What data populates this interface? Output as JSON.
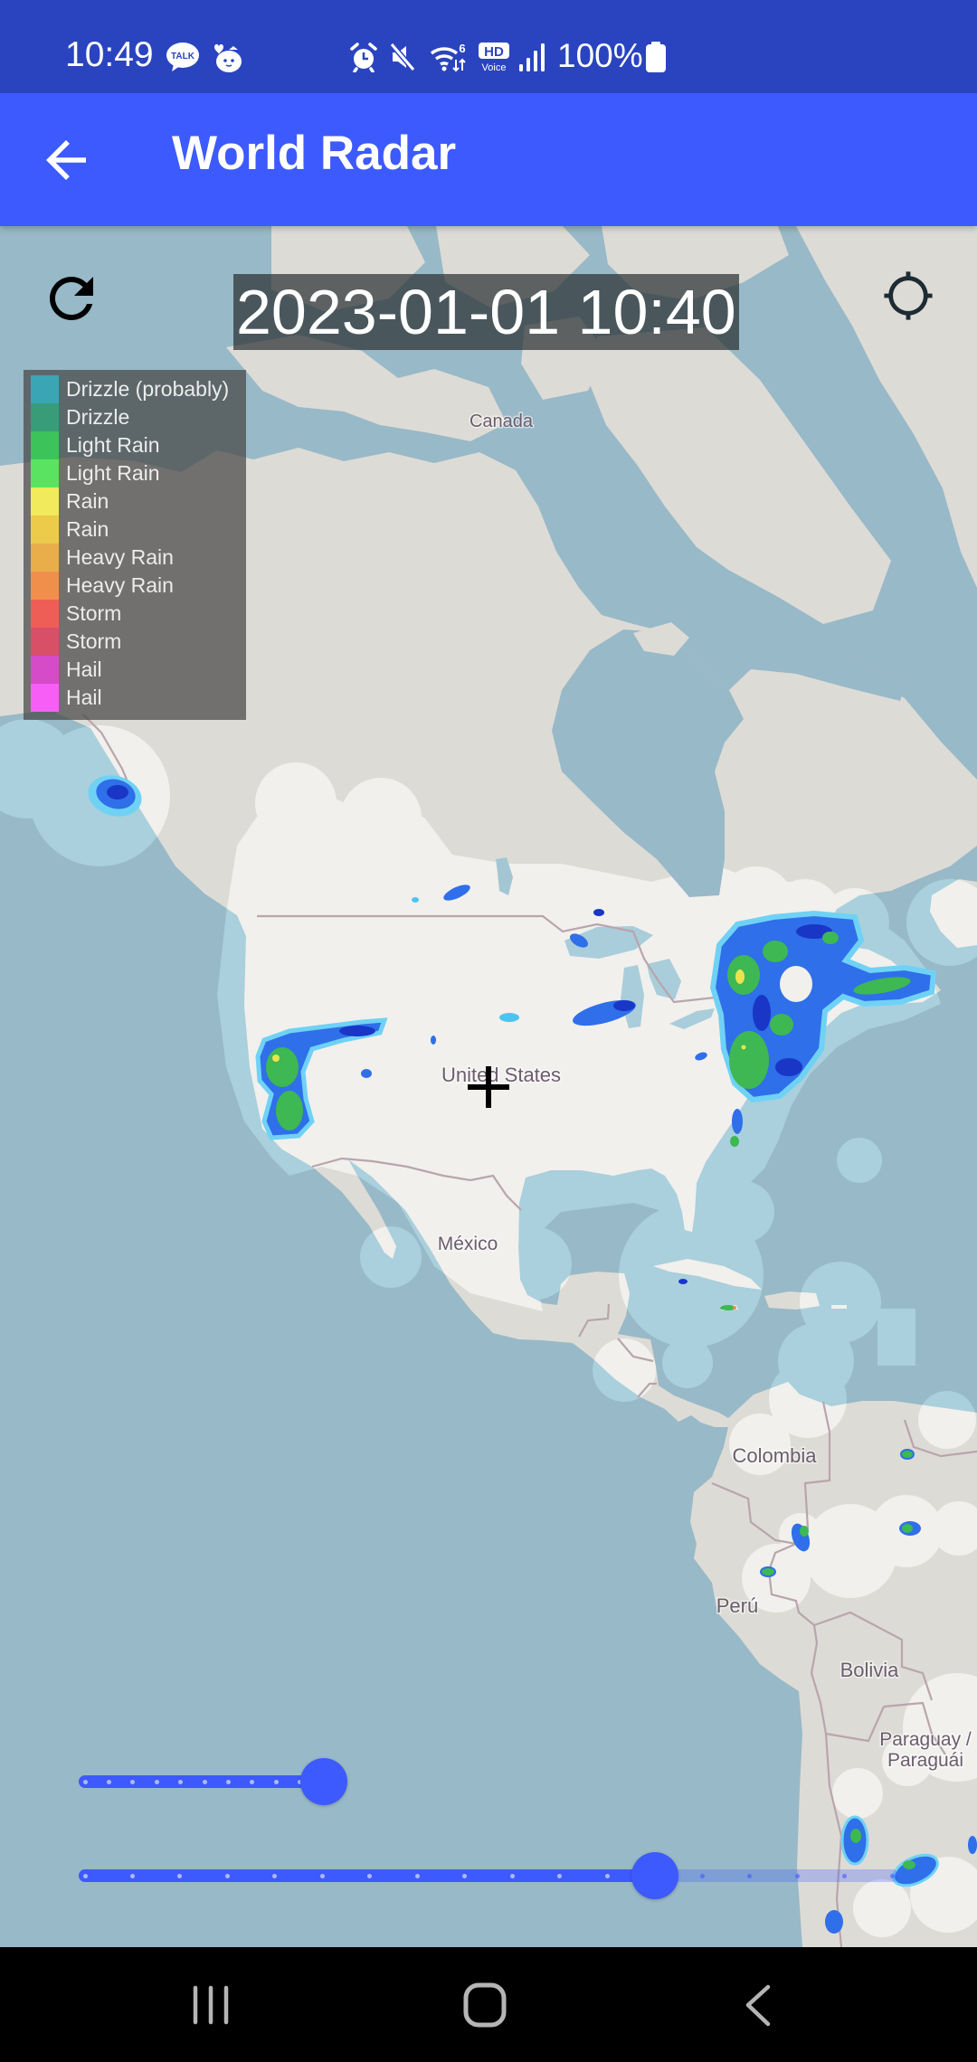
{
  "theme": {
    "status_bar": "#2a44c0",
    "app_bar": "#3d5afe",
    "accent": "#3d5afe"
  },
  "status_bar": {
    "time": "10:49",
    "notification_icons": [
      {
        "name": "kakaotalk-icon",
        "text": "TALK"
      },
      {
        "name": "kakao-character-icon"
      }
    ],
    "system_icons": [
      "alarm-icon",
      "mute-icon",
      "wifi-icon",
      "hd-voice-icon",
      "signal-icon",
      "battery-icon"
    ],
    "wifi_badge": "6",
    "hd_voice": {
      "top": "HD",
      "bottom": "Voice"
    },
    "battery_level": "100%"
  },
  "app_bar": {
    "title": "World Radar",
    "back_icon": "arrow-back-icon"
  },
  "map": {
    "timestamp": "2023-01-01 10:40",
    "refresh_icon": "refresh-icon",
    "locate_icon": "gps-locate-icon",
    "center_marker_icon": "crosshair-plus-icon",
    "labels": {
      "canada": "Canada",
      "united_states": "United States",
      "mexico": "México",
      "colombia": "Colombia",
      "peru": "Perú",
      "bolivia": "Bolivia",
      "paraguay_line1": "Paraguay /",
      "paraguay_line2": "Paraguái"
    }
  },
  "legend": {
    "items": [
      {
        "label": "Drizzle (probably)",
        "color": "#3aa6b5"
      },
      {
        "label": "Drizzle",
        "color": "#389c78"
      },
      {
        "label": "Light Rain",
        "color": "#3cc45a"
      },
      {
        "label": "Light Rain",
        "color": "#5ae360"
      },
      {
        "label": "Rain",
        "color": "#f0ea5c"
      },
      {
        "label": "Rain",
        "color": "#eccb4b"
      },
      {
        "label": "Heavy Rain",
        "color": "#e9ae4a"
      },
      {
        "label": "Heavy Rain",
        "color": "#f08f4c"
      },
      {
        "label": "Storm",
        "color": "#ee5e56"
      },
      {
        "label": "Storm",
        "color": "#d84f68"
      },
      {
        "label": "Hail",
        "color": "#d64bc8"
      },
      {
        "label": "Hail",
        "color": "#f75ef5"
      }
    ]
  },
  "sliders": [
    {
      "value": 10,
      "min": 0,
      "max": 10,
      "divisions": 10
    },
    {
      "value": 12,
      "min": 0,
      "max": 17,
      "divisions": 17
    }
  ],
  "nav_bar": {
    "recent_icon": "recent-apps-icon",
    "home_icon": "home-icon",
    "back_icon": "back-icon"
  }
}
